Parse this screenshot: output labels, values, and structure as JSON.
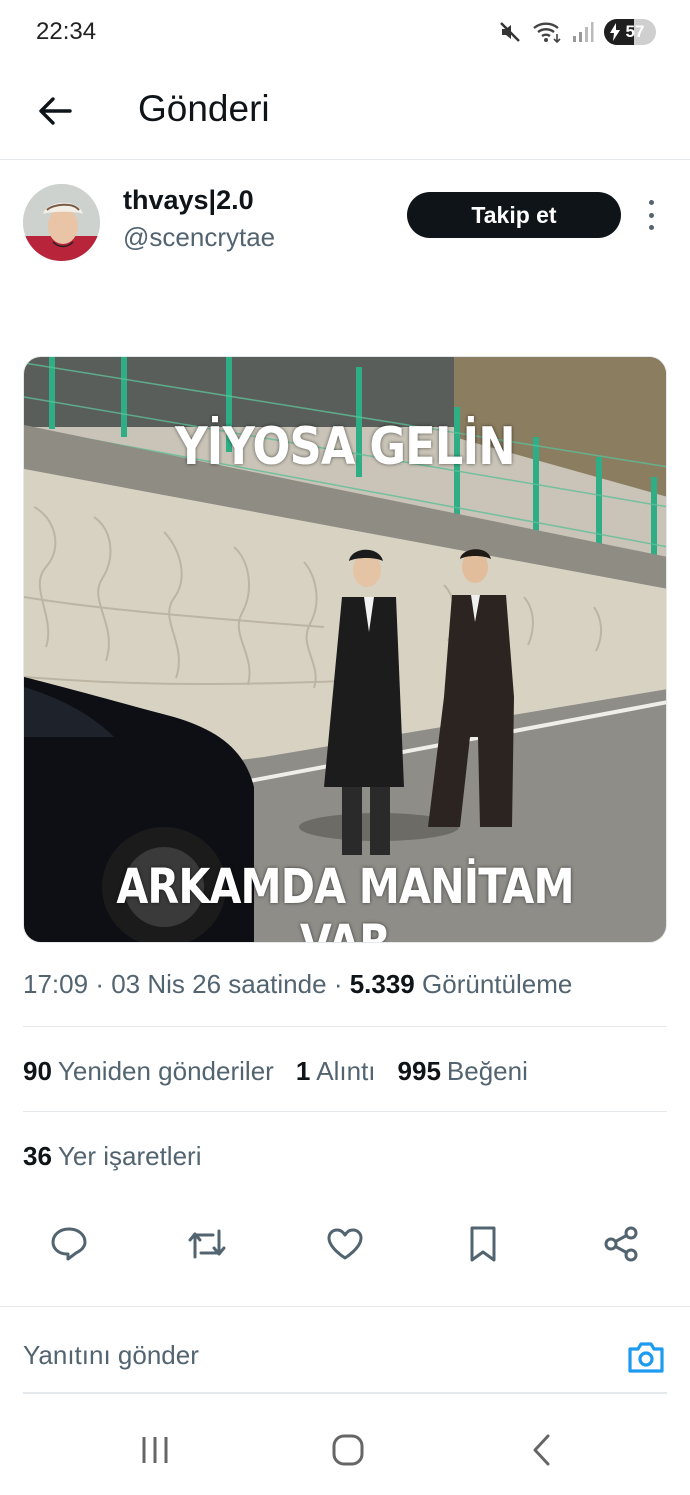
{
  "status_bar": {
    "time": "22:34",
    "battery_level": "57",
    "icons": [
      "mute-icon",
      "wifi-icon",
      "signal-icon",
      "battery-icon"
    ]
  },
  "header": {
    "title": "Gönderi",
    "back_icon": "arrow-left-icon"
  },
  "post": {
    "display_name": "thvays|2.0",
    "handle": "@scencrytae",
    "follow_label": "Takip et",
    "more_icon": "more-vertical-icon",
    "media": {
      "top_text": "YİYOSA GELİN",
      "bottom_text": "ARKAMDA MANİTAM VAR"
    },
    "meta": {
      "time": "17:09",
      "date": "03 Nis 26 saatinde",
      "views_count": "5.339",
      "views_label": "Görüntüleme"
    },
    "stats": {
      "reposts_count": "90",
      "reposts_label": "Yeniden gönderiler",
      "quotes_count": "1",
      "quotes_label": "Alıntı",
      "likes_count": "995",
      "likes_label": "Beğeni",
      "bookmarks_count": "36",
      "bookmarks_label": "Yer işaretleri"
    },
    "actions": [
      "reply-icon",
      "repost-icon",
      "like-icon",
      "bookmark-icon",
      "share-icon"
    ]
  },
  "reply": {
    "placeholder": "Yanıtını gönder",
    "camera_icon": "camera-icon",
    "accent_color": "#1d9bf0"
  },
  "nav_bar": {
    "icons": [
      "recent-apps-icon",
      "home-icon",
      "back-icon"
    ]
  }
}
